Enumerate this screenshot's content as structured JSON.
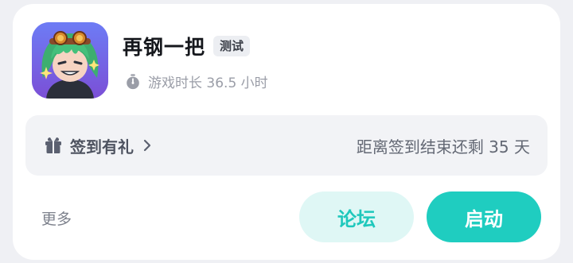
{
  "app": {
    "title": "再钢一把",
    "tag": "测试",
    "playtime": "游戏时长 36.5 小时",
    "icon": "game-character-avatar"
  },
  "signin": {
    "label": "签到有礼",
    "countdown": "距离签到结束还剩 35 天",
    "icon": "gift-icon"
  },
  "actions": {
    "more": "更多",
    "forum": "论坛",
    "launch": "启动"
  },
  "colors": {
    "accent": "#1fcdc0",
    "accent_light": "#dff7f5",
    "card_bg": "#ffffff",
    "page_bg": "#eff0f4",
    "signin_bg": "#f2f3f6"
  }
}
